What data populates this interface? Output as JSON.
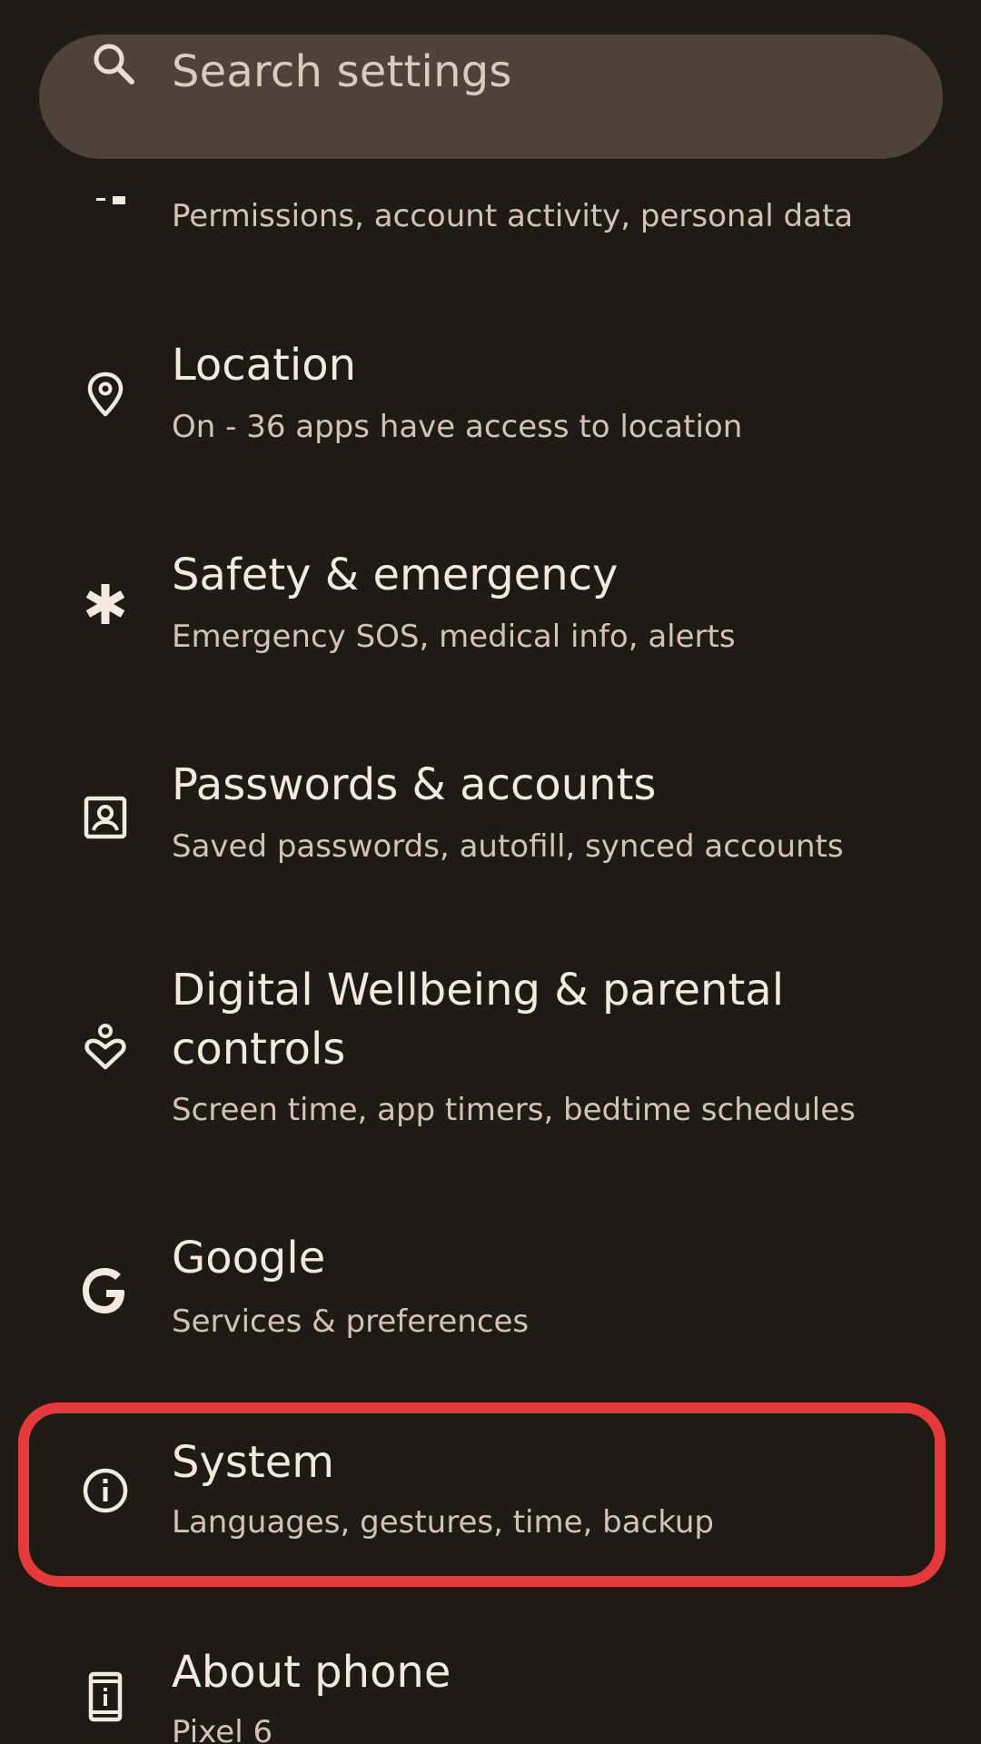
{
  "search": {
    "placeholder": "Search settings",
    "icon": "search-icon"
  },
  "partial_item": {
    "subtitle": "Permissions, account activity, personal data",
    "icon": "privacy-icon"
  },
  "items": [
    {
      "title": "Location",
      "subtitle": "On - 36 apps have access to location",
      "icon": "location-pin-icon"
    },
    {
      "title": "Safety & emergency",
      "subtitle": "Emergency SOS, medical info, alerts",
      "icon": "asterisk-icon"
    },
    {
      "title": "Passwords & accounts",
      "subtitle": "Saved passwords, autofill, synced accounts",
      "icon": "account-box-icon"
    },
    {
      "title_line1": "Digital Wellbeing & parental",
      "title_line2": "controls",
      "subtitle": "Screen time, app timers, bedtime schedules",
      "icon": "wellbeing-heart-icon"
    },
    {
      "title": "Google",
      "subtitle": "Services & preferences",
      "icon": "google-g-icon"
    },
    {
      "title": "System",
      "subtitle": "Languages, gestures, time, backup",
      "icon": "info-circle-icon",
      "highlighted": true
    },
    {
      "title": "About phone",
      "subtitle": "Pixel 6",
      "icon": "phone-info-icon"
    }
  ],
  "colors": {
    "background": "#211a13",
    "search_bar": "#4d4339",
    "highlight_border": "#e43a3d",
    "title_text": "#f3e9df",
    "subtitle_text": "#d0c4b7"
  }
}
